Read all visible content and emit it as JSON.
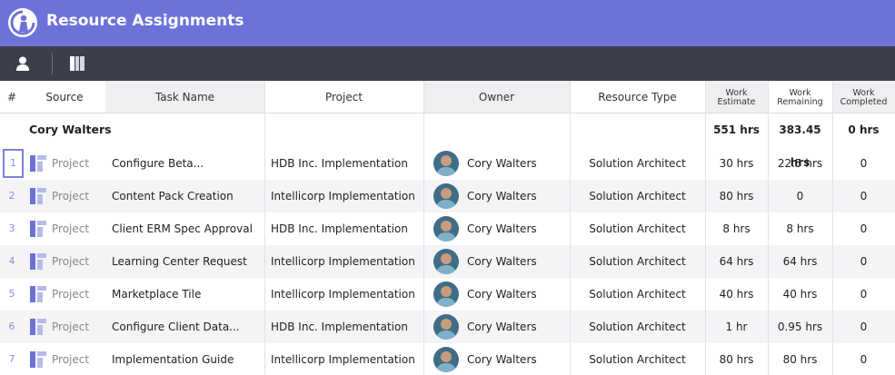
{
  "app": {
    "title": "Resource Assignments",
    "accent_color": "#6c72d8",
    "toolbar_color": "#3d3e4c"
  },
  "toolbar": {
    "icons": [
      "user-icon",
      "columns-icon"
    ]
  },
  "columns": {
    "num": "#",
    "source": "Source",
    "task": "Task Name",
    "project": "Project",
    "owner": "Owner",
    "resource_type": "Resource Type",
    "work_estimate_1": "Work",
    "work_estimate_2": "Estimate",
    "work_remaining_1": "Work",
    "work_remaining_2": "Remaining",
    "work_completed_1": "Work",
    "work_completed_2": "Completed"
  },
  "group": {
    "name": "Cory Walters",
    "work_estimate": "551 hrs",
    "work_remaining": "383.45 hrs",
    "work_completed": "0 hrs"
  },
  "rows": [
    {
      "num": "1",
      "source": "Project",
      "task": "Configure Beta...",
      "project": "HDB Inc. Implementation",
      "owner": "Cory Walters",
      "resource_type": "Solution Architect",
      "work_estimate": "30 hrs",
      "work_remaining": "22.5 hrs",
      "work_completed": "0"
    },
    {
      "num": "2",
      "source": "Project",
      "task": "Content Pack Creation",
      "project": "Intellicorp Implementation",
      "owner": "Cory Walters",
      "resource_type": "Solution Architect",
      "work_estimate": "80 hrs",
      "work_remaining": "0",
      "work_completed": "0"
    },
    {
      "num": "3",
      "source": "Project",
      "task": "Client ERM Spec Approval",
      "project": "HDB Inc. Implementation",
      "owner": "Cory Walters",
      "resource_type": "Solution Architect",
      "work_estimate": "8 hrs",
      "work_remaining": "8 hrs",
      "work_completed": "0"
    },
    {
      "num": "4",
      "source": "Project",
      "task": "Learning Center Request",
      "project": "Intellicorp Implementation",
      "owner": "Cory Walters",
      "resource_type": "Solution Architect",
      "work_estimate": "64 hrs",
      "work_remaining": "64 hrs",
      "work_completed": "0"
    },
    {
      "num": "5",
      "source": "Project",
      "task": "Marketplace Tile",
      "project": "Intellicorp Implementation",
      "owner": "Cory Walters",
      "resource_type": "Solution Architect",
      "work_estimate": "40 hrs",
      "work_remaining": "40 hrs",
      "work_completed": "0"
    },
    {
      "num": "6",
      "source": "Project",
      "task": "Configure Client Data...",
      "project": "HDB Inc. Implementation",
      "owner": "Cory Walters",
      "resource_type": "Solution Architect",
      "work_estimate": "1 hr",
      "work_remaining": "0.95 hrs",
      "work_completed": "0"
    },
    {
      "num": "7",
      "source": "Project",
      "task": "Implementation Guide",
      "project": "Intellicorp Implementation",
      "owner": "Cory Walters",
      "resource_type": "Solution Architect",
      "work_estimate": "80 hrs",
      "work_remaining": "80 hrs",
      "work_completed": "0"
    }
  ]
}
